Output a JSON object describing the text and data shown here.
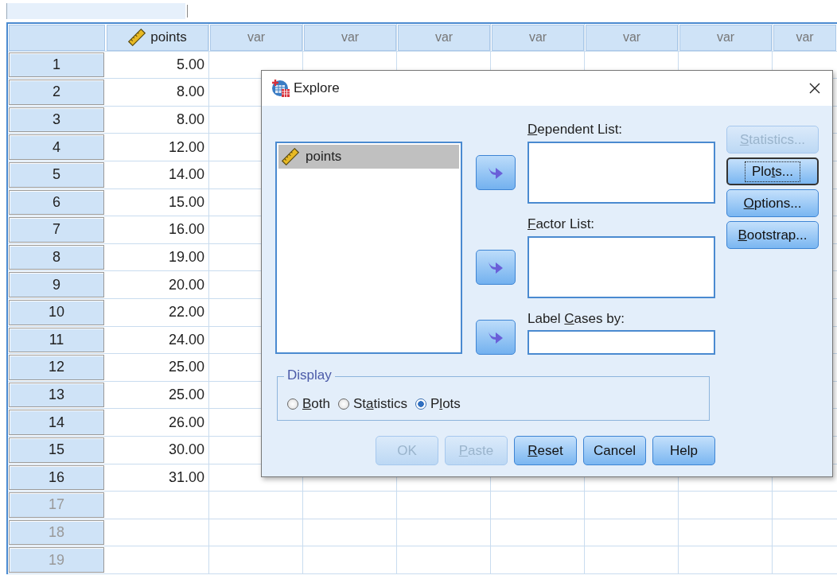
{
  "cell_editor": {
    "kind": "field"
  },
  "data_view": {
    "columns": [
      {
        "label": "points",
        "kind": "variable"
      },
      {
        "label": "var",
        "kind": "empty"
      },
      {
        "label": "var",
        "kind": "empty"
      },
      {
        "label": "var",
        "kind": "empty"
      },
      {
        "label": "var",
        "kind": "empty"
      },
      {
        "label": "var",
        "kind": "empty"
      },
      {
        "label": "var",
        "kind": "empty"
      },
      {
        "label": "var",
        "kind": "empty"
      }
    ],
    "rows": [
      {
        "case": "1",
        "points": "5.00",
        "filled": true
      },
      {
        "case": "2",
        "points": "8.00",
        "filled": true
      },
      {
        "case": "3",
        "points": "8.00",
        "filled": true
      },
      {
        "case": "4",
        "points": "12.00",
        "filled": true
      },
      {
        "case": "5",
        "points": "14.00",
        "filled": true
      },
      {
        "case": "6",
        "points": "15.00",
        "filled": true
      },
      {
        "case": "7",
        "points": "16.00",
        "filled": true
      },
      {
        "case": "8",
        "points": "19.00",
        "filled": true
      },
      {
        "case": "9",
        "points": "20.00",
        "filled": true
      },
      {
        "case": "10",
        "points": "22.00",
        "filled": true
      },
      {
        "case": "11",
        "points": "24.00",
        "filled": true
      },
      {
        "case": "12",
        "points": "25.00",
        "filled": true
      },
      {
        "case": "13",
        "points": "25.00",
        "filled": true
      },
      {
        "case": "14",
        "points": "26.00",
        "filled": true
      },
      {
        "case": "15",
        "points": "30.00",
        "filled": true
      },
      {
        "case": "16",
        "points": "31.00",
        "filled": true
      },
      {
        "case": "17",
        "filled": false
      },
      {
        "case": "18",
        "filled": false
      },
      {
        "case": "19",
        "filled": false
      }
    ]
  },
  "dialog": {
    "title": "Explore",
    "source_list": [
      {
        "label": "points",
        "selected": true
      }
    ],
    "target_lists": [
      {
        "key": "D",
        "after": "ependent List:",
        "kind": "multi"
      },
      {
        "key": "F",
        "after": "actor List:",
        "kind": "multi"
      },
      {
        "before": "Label ",
        "key": "C",
        "after": "ases by:",
        "kind": "single"
      }
    ],
    "side_buttons": [
      {
        "key": "S",
        "after": "tatistics...",
        "disabled": true,
        "focused": false
      },
      {
        "before": "Plo",
        "key": "t",
        "after": "s...",
        "disabled": false,
        "focused": true
      },
      {
        "key": "O",
        "after": "ptions...",
        "disabled": false,
        "focused": false
      },
      {
        "key": "B",
        "after": "ootstrap...",
        "disabled": false,
        "focused": false
      }
    ],
    "display": {
      "legend": "Display",
      "options": [
        {
          "key": "B",
          "after": "oth",
          "selected": false
        },
        {
          "before": "St",
          "key": "a",
          "after": "tistics",
          "selected": false
        },
        {
          "before": "P",
          "key": "l",
          "after": "ots",
          "selected": true
        }
      ]
    },
    "buttons": [
      {
        "after": "OK",
        "disabled": true
      },
      {
        "key": "P",
        "after": "aste",
        "disabled": true
      },
      {
        "key": "R",
        "after": "eset",
        "disabled": false
      },
      {
        "after": "Cancel",
        "disabled": false
      },
      {
        "after": "Help",
        "disabled": false
      }
    ]
  }
}
